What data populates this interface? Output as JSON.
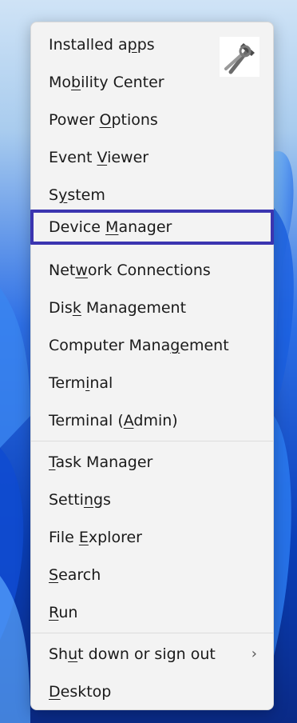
{
  "menu": {
    "items": [
      {
        "id": "installed-apps",
        "pre": "Installed a",
        "key": "p",
        "post": "ps"
      },
      {
        "id": "mobility-center",
        "pre": "Mo",
        "key": "b",
        "post": "ility Center"
      },
      {
        "id": "power-options",
        "pre": "Power ",
        "key": "O",
        "post": "ptions"
      },
      {
        "id": "event-viewer",
        "pre": "Event ",
        "key": "V",
        "post": "iewer"
      },
      {
        "id": "system",
        "pre": "S",
        "key": "y",
        "post": "stem"
      },
      {
        "id": "device-manager",
        "pre": "Device ",
        "key": "M",
        "post": "anager"
      },
      {
        "id": "network-connections",
        "pre": "Net",
        "key": "w",
        "post": "ork Connections"
      },
      {
        "id": "disk-management",
        "pre": "Dis",
        "key": "k",
        "post": " Management"
      },
      {
        "id": "computer-management",
        "pre": "Computer Mana",
        "key": "g",
        "post": "ement"
      },
      {
        "id": "terminal",
        "pre": "Term",
        "key": "i",
        "post": "nal"
      },
      {
        "id": "terminal-admin",
        "pre": "Terminal (",
        "key": "A",
        "post": "dmin)"
      },
      {
        "id": "task-manager",
        "pre": "",
        "key": "T",
        "post": "ask Manager"
      },
      {
        "id": "settings",
        "pre": "Setti",
        "key": "n",
        "post": "gs"
      },
      {
        "id": "file-explorer",
        "pre": "File ",
        "key": "E",
        "post": "xplorer"
      },
      {
        "id": "search",
        "pre": "",
        "key": "S",
        "post": "earch"
      },
      {
        "id": "run",
        "pre": "",
        "key": "R",
        "post": "un"
      },
      {
        "id": "shut-down",
        "pre": "Sh",
        "key": "u",
        "post": "t down or sign out"
      },
      {
        "id": "desktop",
        "pre": "",
        "key": "D",
        "post": "esktop"
      }
    ],
    "selected": "device-manager",
    "submenu_chevron": "›"
  },
  "icons": {
    "tool": "hammer-wrench-icon",
    "submenu": "chevron-right-icon"
  },
  "colors": {
    "menu_bg": "#f3f3f3",
    "selection_border": "#3b35b0",
    "text": "#1a1a1a"
  }
}
